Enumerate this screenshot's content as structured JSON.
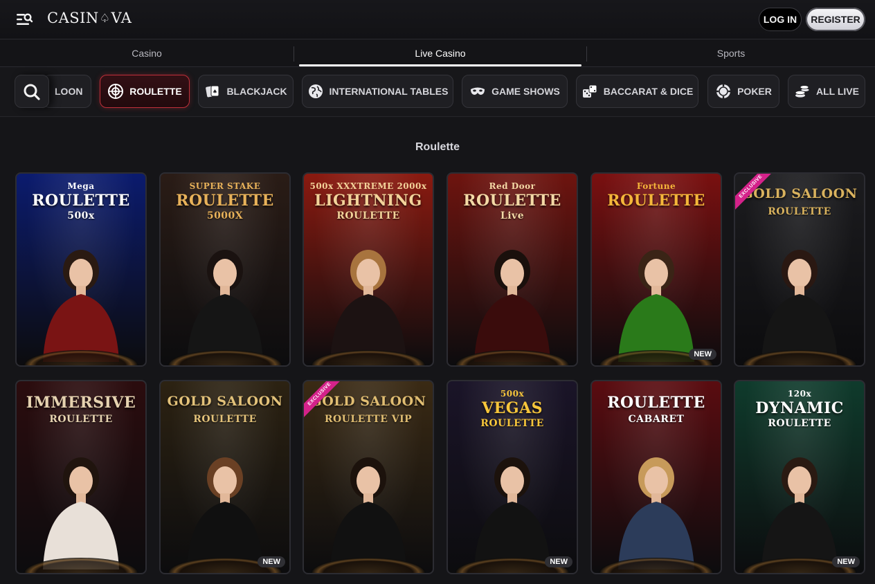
{
  "header": {
    "logo_prefix": "CASIN",
    "logo_suffix": "VA",
    "login_label": "LOG IN",
    "register_label": "REGISTER"
  },
  "tabs": [
    {
      "label": "Casino",
      "active": false
    },
    {
      "label": "Live Casino",
      "active": true
    },
    {
      "label": "Sports",
      "active": false
    }
  ],
  "categories": [
    {
      "label": "LOON",
      "icon": "partial-icon",
      "active": false
    },
    {
      "label": "ROULETTE",
      "icon": "roulette-wheel-icon",
      "active": true
    },
    {
      "label": "BLACKJACK",
      "icon": "cards-icon",
      "active": false
    },
    {
      "label": "INTERNATIONAL TABLES",
      "icon": "globe-icon",
      "active": false
    },
    {
      "label": "GAME SHOWS",
      "icon": "mask-icon",
      "active": false
    },
    {
      "label": "BACCARAT & DICE",
      "icon": "dice-icon",
      "active": false
    },
    {
      "label": "POKER",
      "icon": "poker-chip-icon",
      "active": false
    },
    {
      "label": "ALL LIVE",
      "icon": "chip-stack-icon",
      "active": false
    }
  ],
  "section_title": "Roulette",
  "games": [
    {
      "pre": "Mega",
      "title": "ROULETTE",
      "sub": "500x",
      "badge": "",
      "ribbon": "",
      "bg": "#0b1b6e",
      "accent": "#ffffff"
    },
    {
      "pre": "SUPER STAKE",
      "title": "ROULETTE",
      "sub": "5000X",
      "badge": "",
      "ribbon": "",
      "bg": "#2a1c16",
      "accent": "#e8b25a"
    },
    {
      "pre": "500x XXXTREME 2000x",
      "title": "LIGHTNING",
      "sub": "ROULETTE",
      "badge": "",
      "ribbon": "",
      "bg": "#8a1a10",
      "accent": "#f3d39a"
    },
    {
      "pre": "Red Door",
      "title": "ROULETTE",
      "sub": "Live",
      "badge": "",
      "ribbon": "",
      "bg": "#6e140f",
      "accent": "#f4d9a6"
    },
    {
      "pre": "Fortune",
      "title": "ROULETTE",
      "sub": "",
      "badge": "NEW",
      "ribbon": "",
      "bg": "#7a1010",
      "accent": "#f5b63a"
    },
    {
      "pre": "",
      "title": "GOLD SALOON",
      "sub": "ROULETTE",
      "badge": "",
      "ribbon": "EXCLUSIVE",
      "bg": "#1c1c1f",
      "accent": "#d9b25e"
    },
    {
      "pre": "",
      "title": "IMMERSIVE",
      "sub": "ROULETTE",
      "badge": "",
      "ribbon": "",
      "bg": "#2b0c0e",
      "accent": "#e6d2b0"
    },
    {
      "pre": "",
      "title": "GOLD SALOON",
      "sub": "ROULETTE",
      "badge": "NEW",
      "ribbon": "",
      "bg": "#2c2212",
      "accent": "#e3c27a"
    },
    {
      "pre": "",
      "title": "GOLD SALOON",
      "sub": "ROULETTE VIP",
      "badge": "",
      "ribbon": "EXCLUSIVE",
      "bg": "#3a2a14",
      "accent": "#e0bd72"
    },
    {
      "pre": "500x",
      "title": "VEGAS",
      "sub": "ROULETTE",
      "badge": "NEW",
      "ribbon": "",
      "bg": "#1a1428",
      "accent": "#f7c63b"
    },
    {
      "pre": "",
      "title": "ROULETTE",
      "sub": "CABARET",
      "badge": "",
      "ribbon": "",
      "bg": "#5a0c10",
      "accent": "#ffffff"
    },
    {
      "pre": "120x",
      "title": "DYNAMIC",
      "sub": "ROULETTE",
      "badge": "NEW",
      "ribbon": "",
      "bg": "#0f3b2c",
      "accent": "#ffffff"
    }
  ]
}
